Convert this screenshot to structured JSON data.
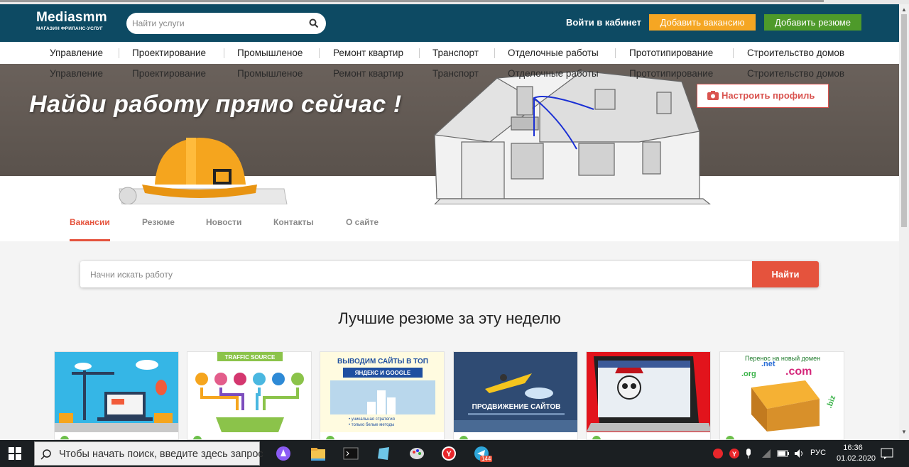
{
  "header": {
    "logo_title": "Mediasmm",
    "logo_subtitle": "МАГАЗИН ФРИЛАНС-УСЛУГ",
    "search_placeholder": "Найти услуги",
    "login_label": "Войти в кабинет",
    "add_vacancy_label": "Добавить вакансию",
    "add_resume_label": "Добавить резюме"
  },
  "categories": [
    "Управление",
    "Проектирование",
    "Промышленое",
    "Ремонт квартир",
    "Транспорт",
    "Отделочные работы",
    "Прототипирование",
    "Строительство домов"
  ],
  "hero": {
    "title": "Найди работу прямо сейчас !",
    "profile_button": "Настроить профиль"
  },
  "tabs": [
    "Вакансии",
    "Резюме",
    "Новости",
    "Контакты",
    "О сайте"
  ],
  "job_search": {
    "placeholder": "Начни искать работу",
    "button": "Найти"
  },
  "section_title": "Лучшие резюме за эту неделю",
  "cards": [
    {
      "label": ""
    },
    {
      "label": "TRAFFIC SOURCE"
    },
    {
      "label": "ВЫВОДИМ САЙТЫ В ТОП",
      "sub": "ЯНДЕКС И GOOGLE",
      "bullets": "• уникальная стратегия\n• только белые методы"
    },
    {
      "label": "ПРОДВИЖЕНИЕ САЙТОВ"
    },
    {
      "label": ""
    },
    {
      "label": "Перенос на новый домен",
      "domains": [
        ".net",
        ".com",
        ".org",
        ".biz"
      ]
    }
  ],
  "taskbar": {
    "search_text": "Чтобы начать поиск, введите здесь запрос",
    "badge": "144",
    "lang": "РУС",
    "time": "16:36",
    "date": "01.02.2020"
  },
  "colors": {
    "header_bg": "#0d4a63",
    "accent_red": "#e5533d",
    "vacancy_orange": "#f5a623",
    "resume_green": "#4e9a2a"
  }
}
